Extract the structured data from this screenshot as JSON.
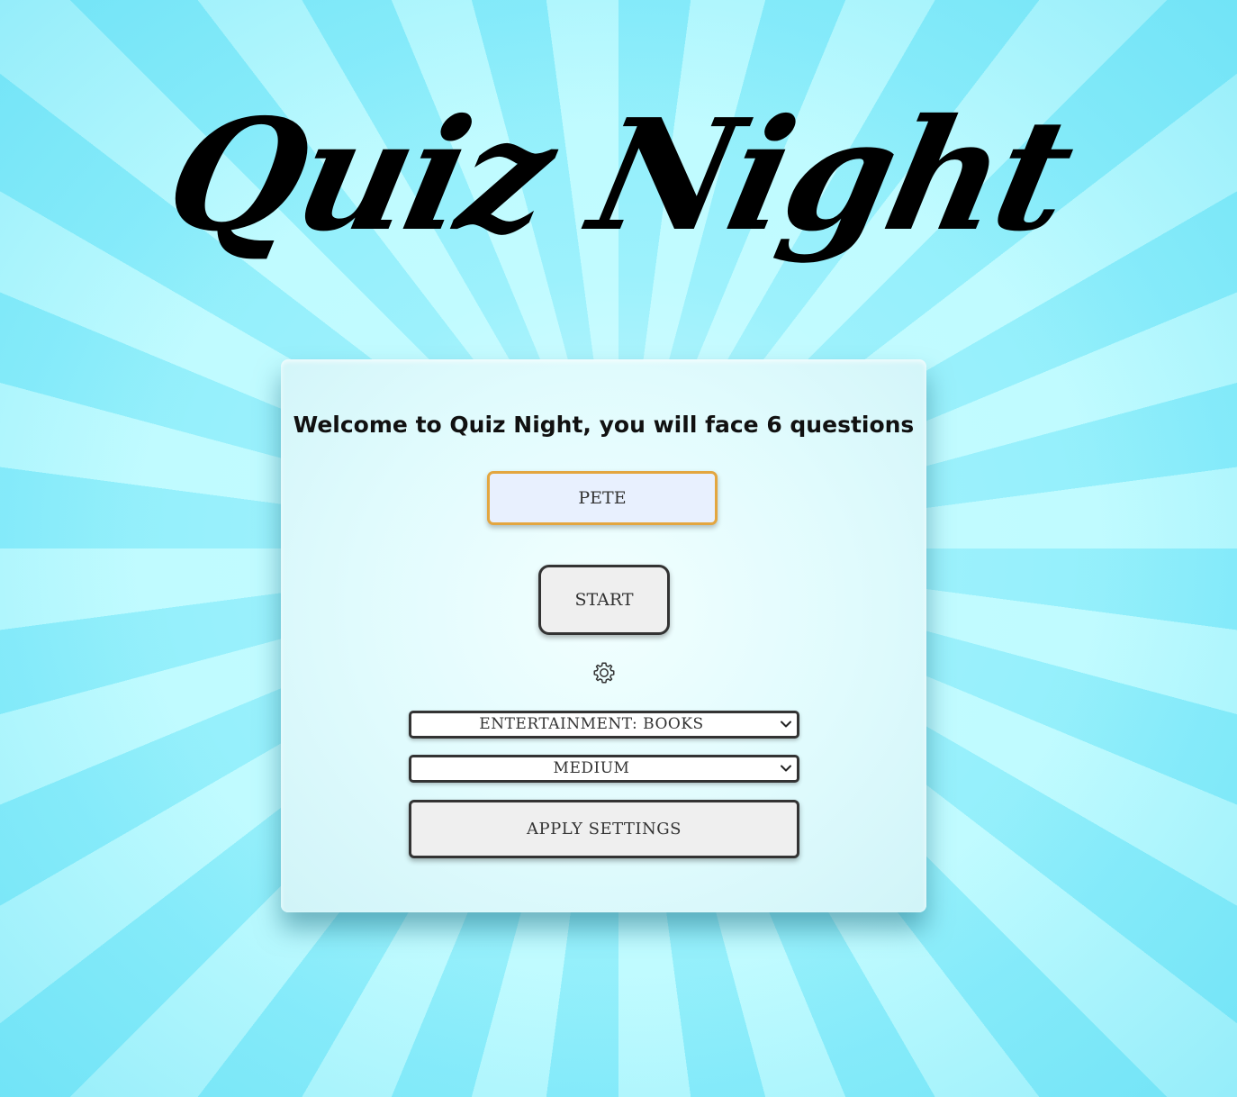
{
  "app": {
    "title": "Quiz Night"
  },
  "welcome": {
    "message": "Welcome to Quiz Night, you will face 6 questions"
  },
  "name_input": {
    "value": "PETE"
  },
  "start_button": {
    "label": "START"
  },
  "settings": {
    "icon": "gear-icon",
    "category": {
      "selected": "ENTERTAINMENT: BOOKS"
    },
    "difficulty": {
      "selected": "MEDIUM"
    },
    "apply_label": "APPLY SETTINGS"
  },
  "colors": {
    "ray_light": "#bffbff",
    "ray_dark": "#8eeefb",
    "input_border": "#e3a640",
    "input_fill": "#e8f0fe"
  }
}
